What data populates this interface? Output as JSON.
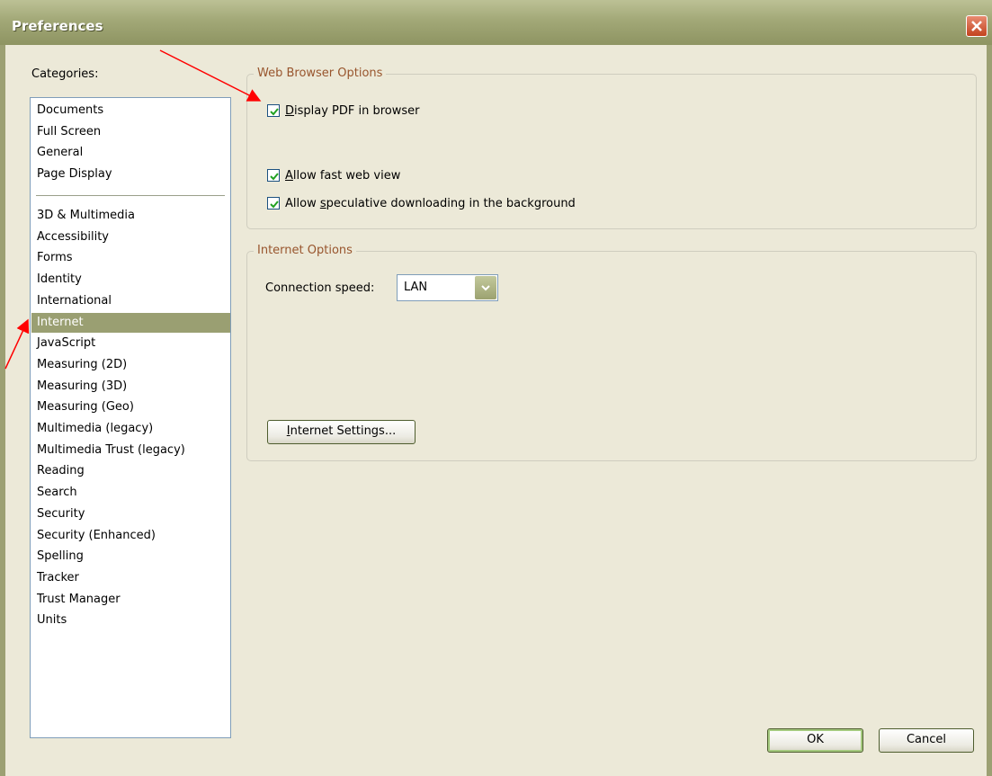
{
  "window": {
    "title": "Preferences"
  },
  "categories": {
    "label": "Categories:",
    "group1": [
      "Documents",
      "Full Screen",
      "General",
      "Page Display"
    ],
    "group2": [
      "3D & Multimedia",
      "Accessibility",
      "Forms",
      "Identity",
      "International",
      "Internet",
      "JavaScript",
      "Measuring (2D)",
      "Measuring (3D)",
      "Measuring (Geo)",
      "Multimedia (legacy)",
      "Multimedia Trust (legacy)",
      "Reading",
      "Search",
      "Security",
      "Security (Enhanced)",
      "Spelling",
      "Tracker",
      "Trust Manager",
      "Units"
    ],
    "selected": "Internet"
  },
  "web_browser_options": {
    "title": "Web Browser Options",
    "display_pdf": {
      "mnemonic": "D",
      "rest": "isplay PDF in browser",
      "checked": true
    },
    "fast_web_view": {
      "mnemonic": "A",
      "rest": "llow fast web view",
      "checked": true
    },
    "speculative": {
      "prefix": "Allow ",
      "mnemonic": "s",
      "rest": "peculative downloading in the background",
      "checked": true
    }
  },
  "internet_options": {
    "title": "Internet Options",
    "connection_speed_label": "Connection speed:",
    "connection_speed_value": "LAN",
    "internet_settings_button": {
      "mnemonic": "I",
      "rest": "nternet Settings..."
    }
  },
  "buttons": {
    "ok": "OK",
    "cancel": "Cancel"
  },
  "colors": {
    "titlebar": "#a2a877",
    "selection": "#9a9f72",
    "group_title": "#98552d",
    "annotation_arrow": "#ff0000"
  }
}
